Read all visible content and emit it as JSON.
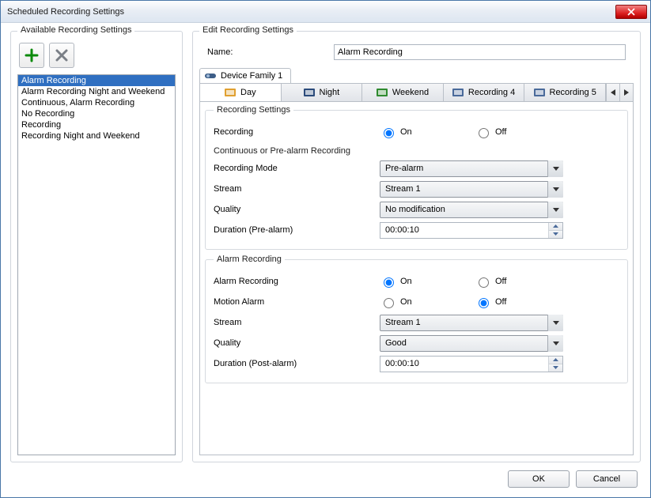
{
  "window": {
    "title": "Scheduled Recording Settings"
  },
  "left": {
    "group_title": "Available Recording Settings",
    "items": [
      "Alarm Recording",
      "Alarm Recording Night and Weekend",
      "Continuous, Alarm Recording",
      "No Recording",
      "Recording",
      "Recording Night and Weekend"
    ],
    "selected_index": 0
  },
  "edit": {
    "group_title": "Edit Recording Settings",
    "name_label": "Name:",
    "name_value": "Alarm Recording",
    "device_tab": "Device Family 1",
    "schedule_tabs": [
      "Day",
      "Night",
      "Weekend",
      "Recording 4",
      "Recording 5"
    ],
    "active_schedule_index": 0
  },
  "rec_settings": {
    "legend": "Recording Settings",
    "recording_label": "Recording",
    "on": "On",
    "off": "Off",
    "recording_value": "On",
    "cont_title": "Continuous or Pre-alarm Recording",
    "mode_label": "Recording Mode",
    "mode_value": "Pre-alarm",
    "stream_label": "Stream",
    "stream_value": "Stream 1",
    "quality_label": "Quality",
    "quality_value": "No modification",
    "duration_pre_label": "Duration (Pre-alarm)",
    "duration_pre_value": "00:00:10"
  },
  "alarm_rec": {
    "legend": "Alarm Recording",
    "alarm_rec_label": "Alarm Recording",
    "alarm_rec_value": "On",
    "motion_label": "Motion Alarm",
    "motion_value": "Off",
    "stream_label": "Stream",
    "stream_value": "Stream 1",
    "quality_label": "Quality",
    "quality_value": "Good",
    "duration_post_label": "Duration (Post-alarm)",
    "duration_post_value": "00:00:10"
  },
  "buttons": {
    "ok": "OK",
    "cancel": "Cancel"
  },
  "icons": {
    "add": "plus-icon",
    "delete": "x-icon",
    "device": "device-icon",
    "schedule": "calendar-icon",
    "chevron_down": "chevron-down-icon",
    "chevron_left": "chevron-left-icon",
    "chevron_right": "chevron-right-icon",
    "spin_up": "spin-up-icon",
    "spin_down": "spin-down-icon",
    "close": "close-icon"
  }
}
